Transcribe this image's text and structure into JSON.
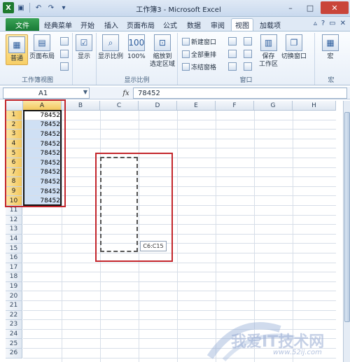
{
  "window": {
    "title": "工作簿3 - Microsoft Excel",
    "app_icon": "X",
    "controls": [
      "–",
      "□",
      "✕"
    ]
  },
  "qat": {
    "icons": [
      "save-icon",
      "undo-icon",
      "redo-icon",
      "customize-icon"
    ]
  },
  "tabs": [
    {
      "label": "文件"
    },
    {
      "label": "经典菜单"
    },
    {
      "label": "开始"
    },
    {
      "label": "插入"
    },
    {
      "label": "页面布局"
    },
    {
      "label": "公式"
    },
    {
      "label": "数据"
    },
    {
      "label": "审阅"
    },
    {
      "label": "视图"
    },
    {
      "label": "加载项"
    }
  ],
  "ribbon": {
    "workbook_views": {
      "label": "工作簿视图",
      "normal": "普通",
      "page_layout": "页面布局"
    },
    "show": {
      "label": "显示"
    },
    "zoom": {
      "label": "显示比例",
      "zoom_btn": "显示比例",
      "zoom100": "100%",
      "zoom_sel_1": "缩放到",
      "zoom_sel_2": "选定区域"
    },
    "window": {
      "label": "窗口",
      "new_window": "新建窗口",
      "arrange_all": "全部重排",
      "freeze_panes": "冻结窗格",
      "save_ws_1": "保存",
      "save_ws_2": "工作区",
      "switch_window": "切换窗口"
    },
    "macros": {
      "label": "宏",
      "macros_btn": "宏"
    }
  },
  "formula_bar": {
    "name_box": "A1",
    "fx": "fx",
    "value": "78452"
  },
  "grid": {
    "columns": [
      "A",
      "B",
      "C",
      "D",
      "E",
      "F",
      "G",
      "H"
    ],
    "rows": [
      "1",
      "2",
      "3",
      "4",
      "5",
      "6",
      "7",
      "8",
      "9",
      "10",
      "11",
      "12",
      "13",
      "14",
      "15",
      "16",
      "17",
      "18",
      "19",
      "20",
      "21",
      "22",
      "23",
      "24",
      "25",
      "26"
    ],
    "a_values": [
      "78452",
      "78452",
      "78452",
      "78452",
      "78452",
      "78452",
      "78452",
      "78452",
      "78452",
      "78452"
    ]
  },
  "tooltip": "C6:C15",
  "watermark": {
    "text": "我爱IT技术网",
    "url": "www.52ij.com"
  }
}
